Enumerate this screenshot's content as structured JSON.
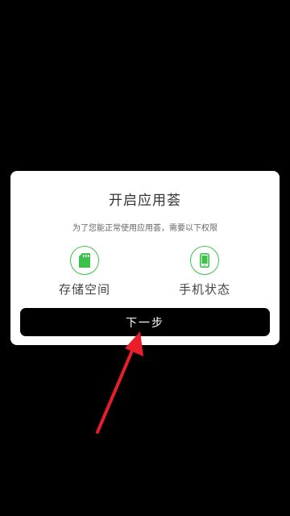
{
  "dialog": {
    "title": "开启应用荟",
    "subtitle": "为了您能正常使用应用荟，需要以下权限",
    "permissions": [
      {
        "label": "存储空间",
        "icon": "sd-card-icon"
      },
      {
        "label": "手机状态",
        "icon": "phone-icon"
      }
    ],
    "next_label": "下一步"
  },
  "colors": {
    "background": "#000000",
    "dialog": "#ffffff",
    "accent_green": "#3cc24a",
    "button": "#000000",
    "annotation_arrow": "#e81e2a"
  }
}
